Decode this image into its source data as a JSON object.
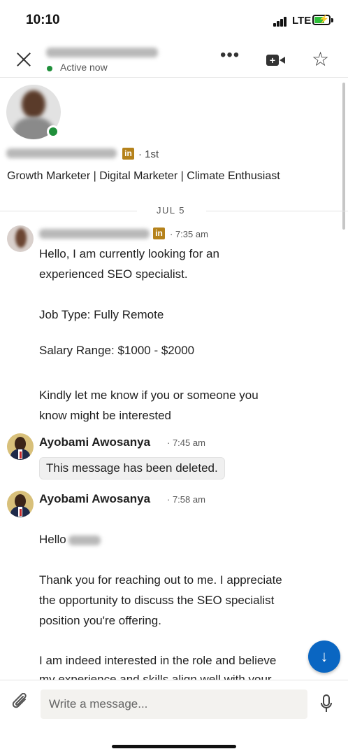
{
  "status_bar": {
    "time": "10:10",
    "network": "LTE"
  },
  "header": {
    "presence": "Active now",
    "more_icon": "more-horizontal-icon",
    "video_icon": "video-call-icon",
    "star_icon": "star-icon"
  },
  "profile": {
    "degree": "· 1st",
    "headline": "Growth Marketer | Digital Marketer | Climate Enthusiast",
    "badge": "in"
  },
  "date_divider": "JUL 5",
  "messages": [
    {
      "time": "7:35 am",
      "badge": "in",
      "lines": [
        "Hello, I am currently looking for an",
        "experienced SEO specialist.",
        "Job Type: Fully Remote",
        "Salary Range: $1000 - $2000",
        "Kindly let me know if you or someone you",
        "know might be interested"
      ]
    },
    {
      "sender": "Ayobami Awosanya",
      "time": "7:45 am",
      "deleted_text": "This message has been deleted."
    },
    {
      "sender": "Ayobami Awosanya",
      "time": "7:58 am",
      "greeting": "Hello",
      "lines": [
        "Thank you for reaching out to me. I appreciate",
        "the opportunity to discuss the SEO specialist",
        "position you're offering.",
        "I am indeed interested in the role and believe",
        "my experience and skills align well with your"
      ]
    }
  ],
  "composer": {
    "placeholder": "Write a message...",
    "attach_icon": "paperclip-icon",
    "mic_icon": "microphone-icon"
  },
  "fab_icon": "arrow-down-icon",
  "colors": {
    "online": "#1f8f3a",
    "linkedin_premium": "#b5821b",
    "fab": "#0a66c2"
  }
}
